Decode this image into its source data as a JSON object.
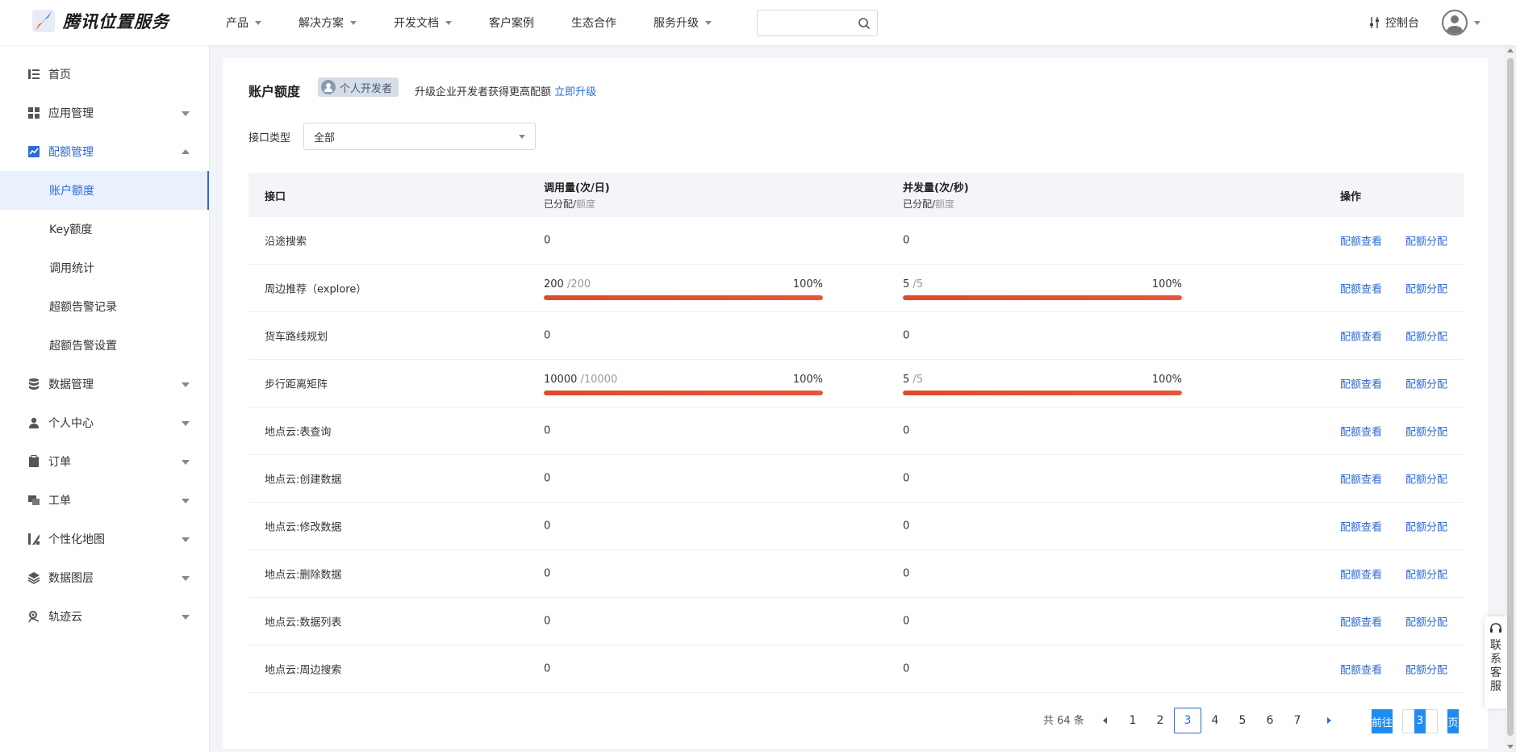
{
  "brand": {
    "name": "腾讯位置服务"
  },
  "nav": [
    {
      "label": "产品",
      "dropdown": true
    },
    {
      "label": "解决方案",
      "dropdown": true
    },
    {
      "label": "开发文档",
      "dropdown": true
    },
    {
      "label": "客户案例",
      "dropdown": false
    },
    {
      "label": "生态合作",
      "dropdown": false
    },
    {
      "label": "服务升级",
      "dropdown": true
    }
  ],
  "search": {
    "placeholder": "",
    "value": ""
  },
  "console_label": "控制台",
  "sidebar": {
    "items": [
      {
        "label": "首页",
        "icon": "list-icon"
      },
      {
        "label": "应用管理",
        "icon": "grid-icon"
      },
      {
        "label": "配额管理",
        "icon": "chart-icon"
      },
      {
        "label": "数据管理",
        "icon": "database-icon"
      },
      {
        "label": "个人中心",
        "icon": "user-icon"
      },
      {
        "label": "订单",
        "icon": "clipboard-icon"
      },
      {
        "label": "工单",
        "icon": "ticket-icon"
      },
      {
        "label": "个性化地图",
        "icon": "map-style-icon"
      },
      {
        "label": "数据图层",
        "icon": "layers-icon"
      },
      {
        "label": "轨迹云",
        "icon": "track-icon"
      }
    ],
    "sub_items": [
      {
        "label": "账户额度",
        "active": true
      },
      {
        "label": "Key额度",
        "active": false
      },
      {
        "label": "调用统计",
        "active": false
      },
      {
        "label": "超额告警记录",
        "active": false
      },
      {
        "label": "超额告警设置",
        "active": false
      }
    ]
  },
  "page": {
    "title": "账户额度",
    "badge": "个人开发者",
    "upgrade_text": "升级企业开发者获得更高配额",
    "upgrade_link": "立即升级",
    "filter_label": "接口类型",
    "filter_value": "全部"
  },
  "table": {
    "headers": {
      "api": "接口",
      "calls": "调用量(次/日)",
      "calls_sub_a": "已分配/",
      "calls_sub_b": "额度",
      "concurrency": "并发量(次/秒)",
      "conc_sub_a": "已分配/",
      "conc_sub_b": "额度",
      "ops": "操作"
    },
    "op_view": "配额查看",
    "op_assign": "配额分配",
    "rows": [
      {
        "name": "沿途搜索",
        "calls": "0",
        "conc": "0"
      },
      {
        "name": "周边推荐（explore）",
        "calls_used": "200",
        "calls_quota": "/200",
        "calls_pct": "100%",
        "calls_frac": 1.0,
        "conc_used": "5",
        "conc_quota": "/5",
        "conc_pct": "100%",
        "conc_frac": 1.0
      },
      {
        "name": "货车路线规划",
        "calls": "0",
        "conc": "0"
      },
      {
        "name": "步行距离矩阵",
        "calls_used": "10000",
        "calls_quota": "/10000",
        "calls_pct": "100%",
        "calls_frac": 1.0,
        "conc_used": "5",
        "conc_quota": "/5",
        "conc_pct": "100%",
        "conc_frac": 1.0
      },
      {
        "name": "地点云:表查询",
        "calls": "0",
        "conc": "0"
      },
      {
        "name": "地点云:创建数据",
        "calls": "0",
        "conc": "0"
      },
      {
        "name": "地点云:修改数据",
        "calls": "0",
        "conc": "0"
      },
      {
        "name": "地点云:删除数据",
        "calls": "0",
        "conc": "0"
      },
      {
        "name": "地点云:数据列表",
        "calls": "0",
        "conc": "0"
      },
      {
        "name": "地点云:周边搜索",
        "calls": "0",
        "conc": "0"
      }
    ]
  },
  "pagination": {
    "total": "共 64 条",
    "pages": [
      "1",
      "2",
      "3",
      "4",
      "5",
      "6",
      "7"
    ],
    "current": "3",
    "goto_label": "前往",
    "goto_value": "3",
    "page_suffix": "页"
  },
  "float_service": {
    "label": "联系客服"
  },
  "colors": {
    "accent": "#2d6ad6",
    "progress": "#e8553a",
    "goto": "#1f8cf0"
  }
}
